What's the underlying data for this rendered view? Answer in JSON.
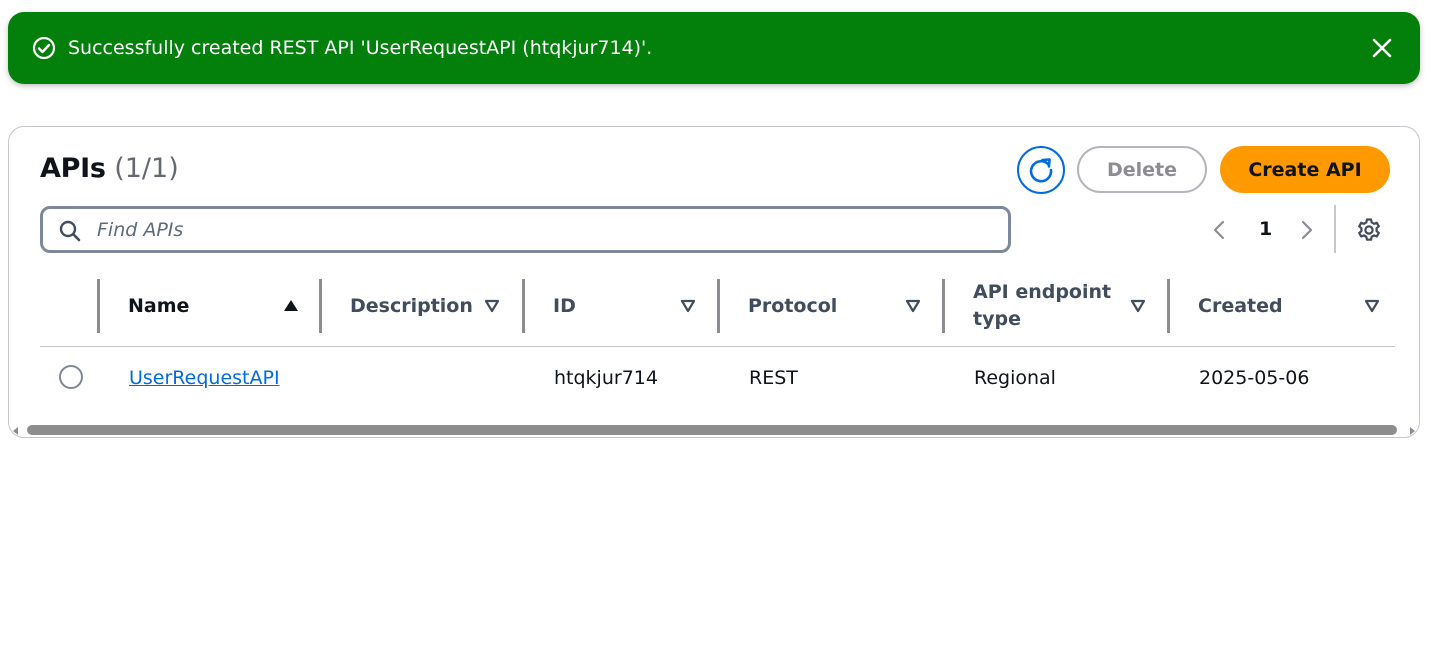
{
  "flash": {
    "message": "Successfully created REST API 'UserRequestAPI (htqkjur714)'.",
    "type": "success",
    "color": "#037f0c",
    "icon": "check-circle-icon",
    "close_icon": "close-icon"
  },
  "header": {
    "title": "APIs",
    "count": "(1/1)",
    "refresh_icon": "refresh-icon",
    "delete_label": "Delete",
    "create_label": "Create API",
    "create_color": "#ff9900"
  },
  "search": {
    "placeholder": "Find APIs"
  },
  "pagination": {
    "current_page": "1"
  },
  "table": {
    "columns": [
      {
        "label": "Name",
        "sort": "ascending"
      },
      {
        "label": "Description",
        "sort": "none"
      },
      {
        "label": "ID",
        "sort": "none"
      },
      {
        "label": "Protocol",
        "sort": "none"
      },
      {
        "label": "API endpoint type",
        "sort": "none"
      },
      {
        "label": "Created",
        "sort": "none"
      }
    ],
    "rows": [
      {
        "selected": false,
        "name": "UserRequestAPI",
        "description": "",
        "id": "htqkjur714",
        "protocol": "REST",
        "endpoint_type": "Regional",
        "created": "2025-05-06"
      }
    ]
  }
}
